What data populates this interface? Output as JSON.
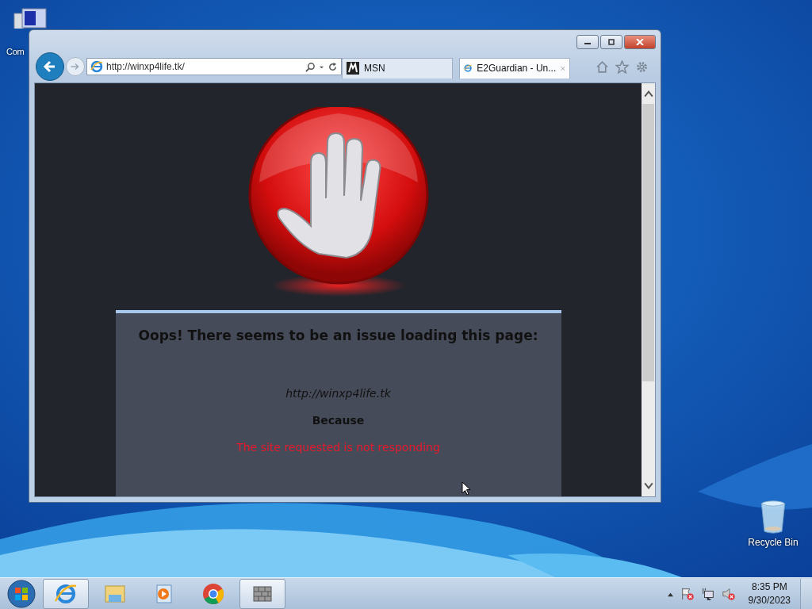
{
  "desktop_icons": [
    {
      "kind": "computer",
      "label": "Com"
    },
    {
      "kind": "recycle",
      "label": "Recycle Bin"
    }
  ],
  "browser": {
    "address": "http://winxp4life.tk/",
    "tabs": [
      {
        "kind": "msn",
        "label": "MSN",
        "selected": false
      },
      {
        "kind": "ie",
        "label": "E2Guardian - Un...",
        "selected": true
      }
    ],
    "page": {
      "heading": "Oops! There seems to be an issue loading this page:",
      "url": "http://winxp4life.tk",
      "because": "Because",
      "reason": "The site requested is not responding"
    }
  },
  "taskbar": {
    "apps": [
      {
        "kind": "ie",
        "active": true
      },
      {
        "kind": "explorer",
        "active": false
      },
      {
        "kind": "media",
        "active": false
      },
      {
        "kind": "chrome",
        "active": false
      },
      {
        "kind": "firewall",
        "active": true
      }
    ],
    "time": "8:35 PM",
    "date": "9/30/2023"
  }
}
